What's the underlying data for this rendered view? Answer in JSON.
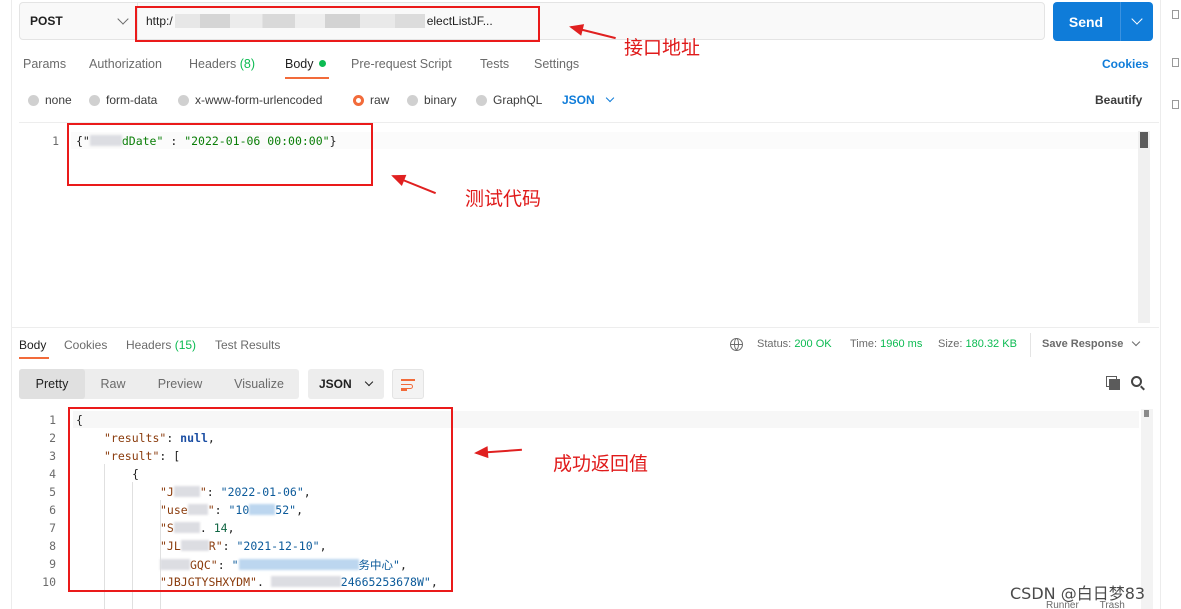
{
  "request": {
    "method": "POST",
    "url_prefix": "http:/",
    "url_suffix": "electListJF...",
    "send_label": "Send"
  },
  "tabs": [
    {
      "label": "Params"
    },
    {
      "label": "Authorization"
    },
    {
      "label": "Headers",
      "count": "(8)"
    },
    {
      "label": "Body"
    },
    {
      "label": "Pre-request Script"
    },
    {
      "label": "Tests"
    },
    {
      "label": "Settings"
    }
  ],
  "cookies_link": "Cookies",
  "body_types": [
    "none",
    "form-data",
    "x-www-form-urlencoded",
    "raw",
    "binary",
    "GraphQL"
  ],
  "body_format": "JSON",
  "beautify_link": "Beautify",
  "request_body": {
    "line_no": "1",
    "open": "{\"",
    "key_tail": "dDate\"",
    "sep": " : ",
    "value": "\"2022-01-06 00:00:00\"",
    "close": "}"
  },
  "annotations": {
    "url": "接口地址",
    "test_code": "测试代码",
    "success": "成功返回值"
  },
  "response": {
    "tabs": [
      {
        "label": "Body"
      },
      {
        "label": "Cookies"
      },
      {
        "label": "Headers",
        "count": "(15)"
      },
      {
        "label": "Test Results"
      }
    ],
    "status_label": "Status:",
    "status_value": "200 OK",
    "time_label": "Time:",
    "time_value": "1960 ms",
    "size_label": "Size:",
    "size_value": "180.32 KB",
    "save_label": "Save Response",
    "view_modes": [
      "Pretty",
      "Raw",
      "Preview",
      "Visualize"
    ],
    "format": "JSON",
    "lines": [
      {
        "n": "1",
        "text": "{"
      },
      {
        "n": "2",
        "key": "\"results\"",
        "rest": ": ",
        "kw": "null",
        "end": ","
      },
      {
        "n": "3",
        "key": "\"result\"",
        "rest": ": ["
      },
      {
        "n": "4",
        "text": "{"
      },
      {
        "n": "5",
        "key_a": "\"J",
        "key_b": "\"",
        "rest": ": ",
        "val": "\"2022-01-06\"",
        "end": ","
      },
      {
        "n": "6",
        "key_a": "\"use",
        "key_b": "\"",
        "rest": ": ",
        "val_a": "\"10",
        "val_b": "52\"",
        "end": ","
      },
      {
        "n": "7",
        "key_a": "\"S",
        "rest": ". ",
        "num": "14",
        "end": ","
      },
      {
        "n": "8",
        "key_a": "\"JL",
        "key_b": "R\"",
        "rest": ": ",
        "val": "\"2021-12-10\"",
        "end": ","
      },
      {
        "n": "9",
        "key_b": "GQC\"",
        "rest": ": ",
        "val_a": "\"",
        "val_b": "务中心\"",
        "end": ","
      },
      {
        "n": "10",
        "key_a": "\"JBJGTYSHXYDM\"",
        "rest": ". ",
        "val_b": "24665253678W\"",
        "end": ","
      }
    ]
  },
  "watermark": "CSDN @白日梦83",
  "bottom_bar": {
    "runner": "Runner",
    "trash": "Trash"
  }
}
